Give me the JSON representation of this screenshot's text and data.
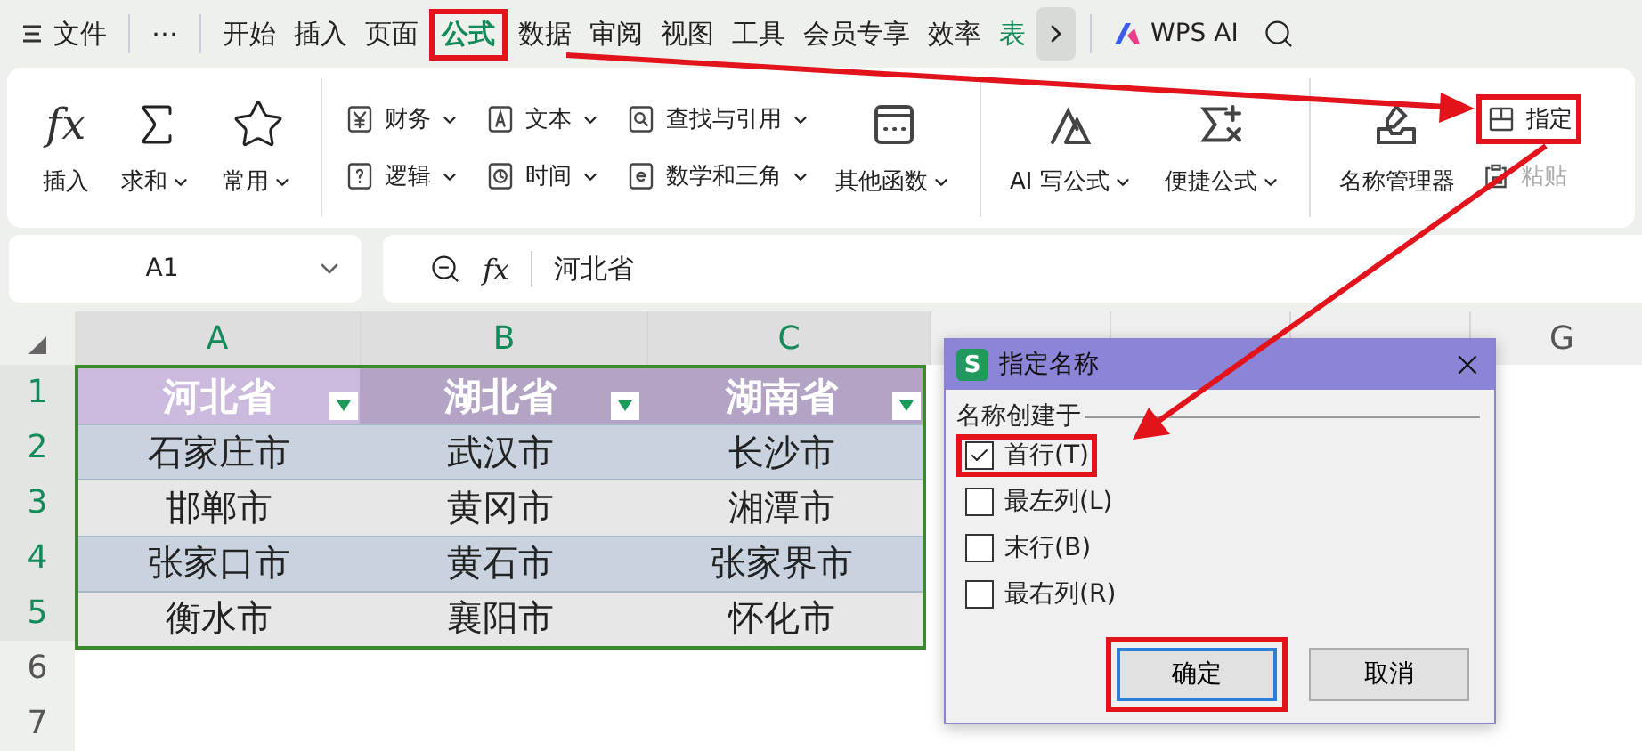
{
  "menu_bar": {
    "file_menu": "文件",
    "more": "⋯",
    "tabs": [
      {
        "label": "开始",
        "selected": false,
        "kind": "normal"
      },
      {
        "label": "插入",
        "selected": false,
        "kind": "normal"
      },
      {
        "label": "页面",
        "selected": false,
        "kind": "normal"
      },
      {
        "label": "公式",
        "selected": true,
        "highlighted": true,
        "kind": "normal"
      },
      {
        "label": "数据",
        "selected": false,
        "kind": "normal"
      },
      {
        "label": "审阅",
        "selected": false,
        "kind": "normal"
      },
      {
        "label": "视图",
        "selected": false,
        "kind": "normal"
      },
      {
        "label": "工具",
        "selected": false,
        "kind": "normal"
      },
      {
        "label": "会员专享",
        "selected": false,
        "kind": "normal"
      },
      {
        "label": "效率",
        "selected": false,
        "kind": "normal"
      },
      {
        "label": "表",
        "selected": false,
        "kind": "accent"
      }
    ],
    "ai_button": "WPS AI"
  },
  "ribbon": {
    "groups": [
      {
        "items": [
          {
            "kind": "large",
            "label": "插入",
            "glyph": "fx",
            "dropdown": false,
            "disabled": false
          },
          {
            "kind": "large",
            "label": "求和",
            "dropdown": true,
            "disabled": false
          },
          {
            "kind": "large",
            "label": "常用",
            "dropdown": true,
            "disabled": false
          }
        ]
      },
      {
        "items": [
          {
            "kind": "small",
            "label": "财务",
            "dropdown": true,
            "disabled": false
          },
          {
            "kind": "small",
            "label": "逻辑",
            "dropdown": true,
            "disabled": false
          },
          {
            "kind": "small",
            "label": "文本",
            "dropdown": true,
            "disabled": false
          },
          {
            "kind": "small",
            "label": "时间",
            "dropdown": true,
            "disabled": false
          },
          {
            "kind": "small",
            "label": "查找与引用",
            "dropdown": true,
            "disabled": false
          },
          {
            "kind": "small",
            "label": "数学和三角",
            "dropdown": true,
            "disabled": false
          },
          {
            "kind": "large",
            "label": "其他函数",
            "dropdown": true,
            "disabled": false
          }
        ]
      },
      {
        "items": [
          {
            "kind": "large",
            "label": "AI 写公式",
            "dropdown": true,
            "disabled": false
          },
          {
            "kind": "large",
            "label": "便捷公式",
            "dropdown": true,
            "disabled": false
          }
        ]
      },
      {
        "items": [
          {
            "kind": "large",
            "label": "名称管理器",
            "dropdown": false,
            "disabled": false
          },
          {
            "kind": "small",
            "label": "指定",
            "dropdown": false,
            "disabled": false,
            "highlighted": true
          },
          {
            "kind": "small",
            "label": "粘贴",
            "dropdown": false,
            "disabled": true
          }
        ]
      }
    ]
  },
  "formula_bar": {
    "name_box": "A1",
    "fx": "fx",
    "value": "河北省"
  },
  "sheet": {
    "columns": [
      {
        "label": "A",
        "selected": true
      },
      {
        "label": "B",
        "selected": true
      },
      {
        "label": "C",
        "selected": true
      },
      {
        "selected": false
      },
      {
        "selected": false
      },
      {
        "selected": false
      },
      {
        "label": "G",
        "selected": false
      }
    ],
    "rows": [
      {
        "label": "1",
        "selected": true
      },
      {
        "label": "2",
        "selected": true
      },
      {
        "label": "3",
        "selected": true
      },
      {
        "label": "4",
        "selected": true
      },
      {
        "label": "5",
        "selected": true
      },
      {
        "label": "6",
        "selected": false
      },
      {
        "label": "7",
        "selected": false
      }
    ],
    "table": {
      "header": [
        {
          "text": "河北省",
          "active": true
        },
        {
          "text": "湖北省",
          "active": false
        },
        {
          "text": "湖南省",
          "active": false
        }
      ],
      "rows": [
        [
          "石家庄市",
          "武汉市",
          "长沙市"
        ],
        [
          "邯郸市",
          "黄冈市",
          "湘潭市"
        ],
        [
          "张家口市",
          "黄石市",
          "张家界市"
        ],
        [
          "衡水市",
          "襄阳市",
          "怀化市"
        ]
      ]
    }
  },
  "dialog": {
    "app_icon": "S",
    "title": "指定名称",
    "group_label": "名称创建于",
    "options": [
      {
        "label": "首行(T)",
        "checked": true,
        "highlighted": true
      },
      {
        "label": "最左列(L)",
        "checked": false
      },
      {
        "label": "末行(B)",
        "checked": false
      },
      {
        "label": "最右列(R)",
        "checked": false
      }
    ],
    "buttons": [
      {
        "label": "确定",
        "default": true,
        "highlighted": true
      },
      {
        "label": "取消",
        "default": false
      }
    ]
  }
}
